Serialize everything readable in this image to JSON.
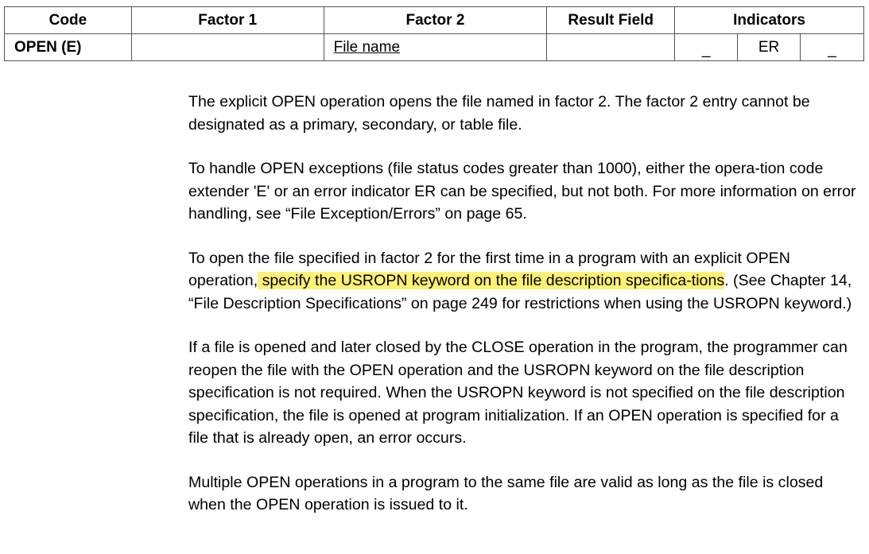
{
  "table": {
    "headers": [
      "Code",
      "Factor 1",
      "Factor 2",
      "Result Field",
      "Indicators"
    ],
    "row": {
      "code": "OPEN (E)",
      "factor1": "",
      "factor2": "File name",
      "result_field": "",
      "indicators": [
        "_",
        "ER",
        "_"
      ]
    }
  },
  "paragraphs": {
    "p1": "The explicit OPEN operation opens the file named in factor 2. The factor 2 entry cannot be designated as a primary, secondary, or table file.",
    "p2": "To handle OPEN exceptions (file status codes greater than 1000), either the opera-tion code extender 'E' or an error indicator ER can be specified, but not both. For more information on error handling, see “File Exception/Errors” on page 65.",
    "p3_before": "To open the file specified in factor 2 for the first time in a program with an explicit OPEN operation,",
    "p3_highlight": " specify the USROPN keyword on the file description specifica-tions",
    "p3_after": ". (See Chapter 14, “File Description Specifications” on page 249 for restrictions when using the USROPN keyword.)",
    "p4": "If a file is opened and later closed by the CLOSE operation in the program, the programmer can reopen the file with the OPEN operation and the USROPN keyword on the file description specification is not required. When the USROPN keyword is not specified on the file description specification, the file is opened at program initialization. If an OPEN operation is specified for a file that is already open, an error occurs.",
    "p5": "Multiple OPEN operations in a program to the same file are valid as long as the file is closed when the OPEN operation is issued to it."
  },
  "colors": {
    "highlight": "#fff176"
  }
}
